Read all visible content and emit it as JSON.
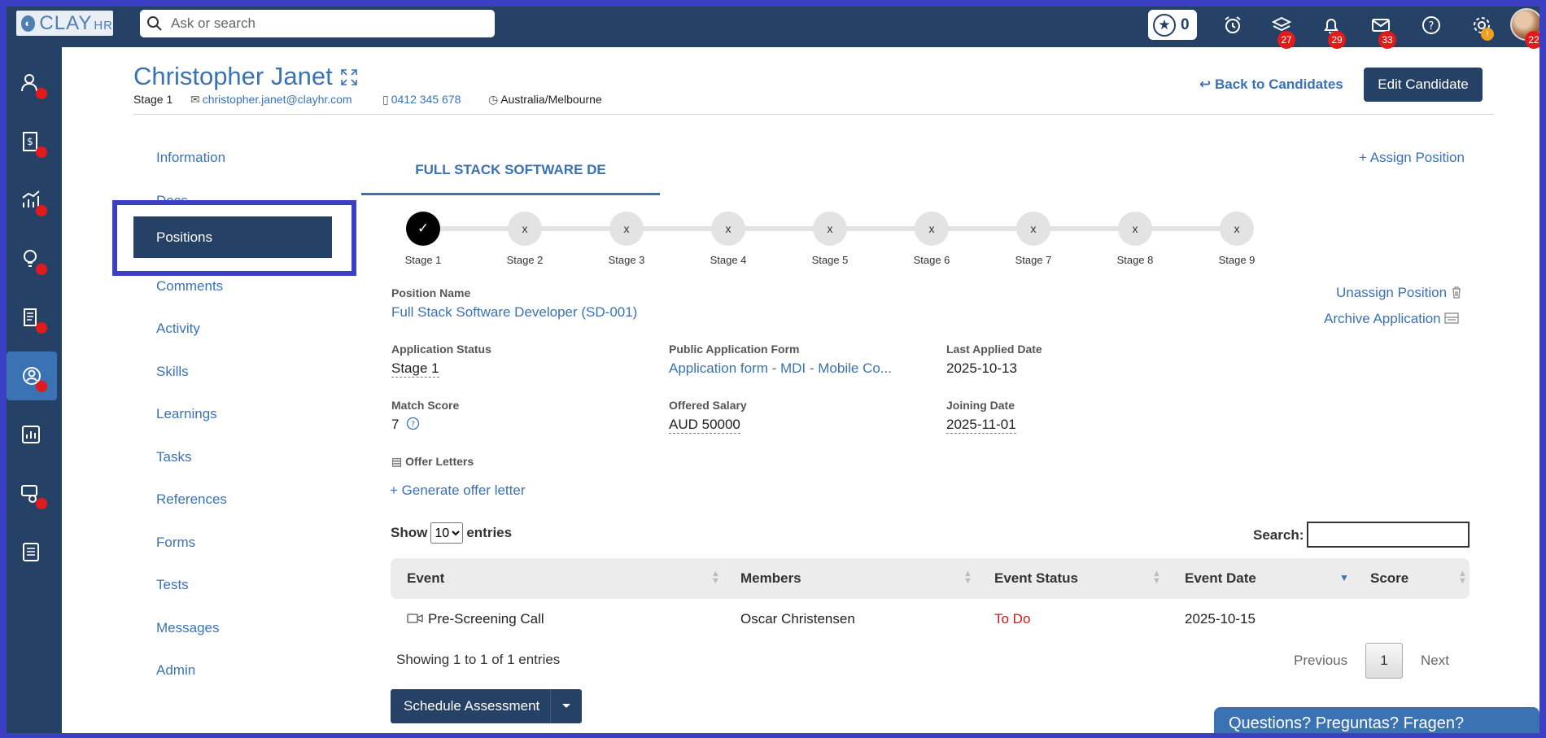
{
  "app": {
    "logo_text": "CLAY",
    "logo_suffix": "HR",
    "search_placeholder": "Ask or search",
    "points": "0",
    "badges": {
      "layers": "27",
      "notifications": "29",
      "messages": "33",
      "settings": "!",
      "avatar": "22"
    }
  },
  "rail": {
    "items": [
      {
        "icon": "people-icon",
        "dot": true
      },
      {
        "icon": "payroll-icon",
        "dot": true
      },
      {
        "icon": "analytics-icon",
        "dot": true
      },
      {
        "icon": "ideas-icon",
        "dot": true
      },
      {
        "icon": "documents-icon",
        "dot": true
      },
      {
        "icon": "recruitment-icon",
        "dot": true,
        "active": true
      },
      {
        "icon": "reports-icon",
        "dot": false
      },
      {
        "icon": "support-icon",
        "dot": true
      },
      {
        "icon": "checklist-icon",
        "dot": false
      }
    ]
  },
  "candidate": {
    "name": "Christopher Janet",
    "stage": "Stage 1",
    "email": "christopher.janet@clayhr.com",
    "phone": "0412 345 678",
    "timezone": "Australia/Melbourne",
    "back_label": "Back to Candidates",
    "edit_label": "Edit Candidate"
  },
  "sidenav": {
    "items": [
      "Information",
      "Docs",
      "Positions",
      "Comments",
      "Activity",
      "Skills",
      "Learnings",
      "Tasks",
      "References",
      "Forms",
      "Tests",
      "Messages",
      "Admin"
    ],
    "active": "Positions"
  },
  "position": {
    "tab_label": "FULL STACK SOFTWARE DE",
    "assign_label": "Assign Position",
    "stages": [
      "Stage 1",
      "Stage 2",
      "Stage 3",
      "Stage 4",
      "Stage 5",
      "Stage 6",
      "Stage 7",
      "Stage 8",
      "Stage 9"
    ],
    "completed_stages": 1,
    "pending_mark": "x",
    "done_mark": "✓",
    "position_name_label": "Position Name",
    "position_name": "Full Stack Software Developer (SD-001)",
    "unassign_label": "Unassign Position",
    "archive_label": "Archive Application",
    "application_status_label": "Application Status",
    "application_status": "Stage 1",
    "public_form_label": "Public Application Form",
    "public_form": "Application form - MDI - Mobile Co...",
    "last_applied_label": "Last Applied Date",
    "last_applied": "2025-10-13",
    "match_score_label": "Match Score",
    "match_score": "7",
    "offered_salary_label": "Offered Salary",
    "offered_salary": "AUD 50000",
    "joining_date_label": "Joining Date",
    "joining_date": "2025-11-01",
    "offer_letters_label": "Offer Letters",
    "generate_offer_label": "Generate offer letter"
  },
  "events_table": {
    "show_label": "Show",
    "entries_label": "entries",
    "page_size": "10",
    "search_label": "Search:",
    "columns": [
      "Event",
      "Members",
      "Event Status",
      "Event Date",
      "Score"
    ],
    "rows": [
      {
        "event": "Pre-Screening Call",
        "members": "Oscar Christensen",
        "status": "To Do",
        "date": "2025-10-15",
        "score": ""
      }
    ],
    "info": "Showing 1 to 1 of 1 entries",
    "prev_label": "Previous",
    "current_page": "1",
    "next_label": "Next"
  },
  "actions": {
    "schedule_label": "Schedule Assessment"
  },
  "help_widget": {
    "label": "Questions? Preguntas? Fragen?"
  },
  "colors": {
    "navy": "#264166",
    "link_blue": "#3a72b4",
    "alert_red": "#e11a1a",
    "frame_blue": "#3b3fc4"
  }
}
